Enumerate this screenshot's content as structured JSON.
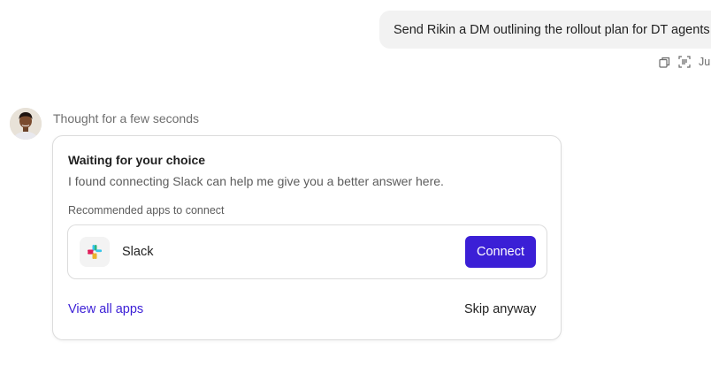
{
  "user_message": {
    "text": "Send Rikin a DM outlining the rollout plan for DT agents",
    "actions": {
      "copy_icon": "copy-icon",
      "scan_icon": "scan-text-icon",
      "timestamp_partial": "Ju"
    }
  },
  "assistant": {
    "avatar": "user-avatar",
    "thought_label": "Thought for a few seconds",
    "card": {
      "title": "Waiting for your choice",
      "description": "I found connecting Slack can help me give you a better answer here.",
      "section_label": "Recommended apps to connect",
      "apps": [
        {
          "name": "Slack",
          "icon": "slack-icon",
          "connect_label": "Connect"
        }
      ],
      "view_all_label": "View all apps",
      "skip_label": "Skip anyway"
    }
  },
  "colors": {
    "accent": "#3b1fd6",
    "bubble_bg": "#f2f2f2",
    "border": "#dcdcdc"
  }
}
